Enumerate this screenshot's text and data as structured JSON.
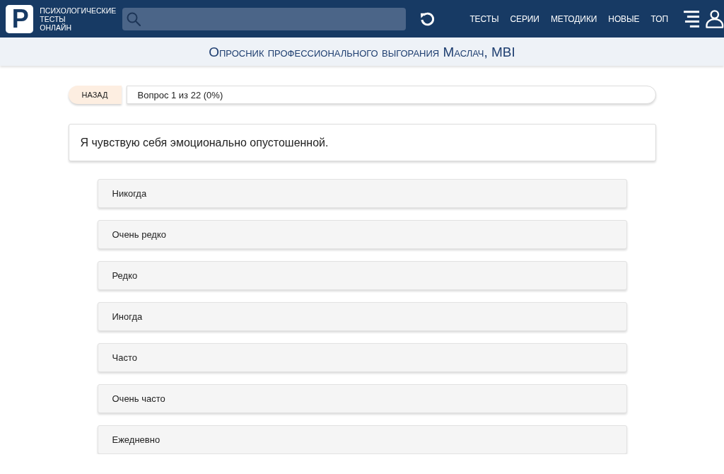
{
  "header": {
    "logo": {
      "letter": "P",
      "lines": [
        "ПСИХОЛОГИЧЕСКИЕ",
        "ТЕСТЫ",
        "ОНЛАЙН"
      ]
    },
    "nav": [
      "ТЕСТЫ",
      "СЕРИИ",
      "МЕТОДИКИ",
      "НОВЫЕ",
      "ТОП"
    ]
  },
  "page_title": "Опросник профессионального выгорания Маслач, MBI",
  "quiz": {
    "back_button": "НАЗАД",
    "progress": "Вопрос 1 из 22 (0%)",
    "question": "Я чувствую себя эмоционально опустошенной.",
    "answers": [
      {
        "label": "Никогда",
        "selected": false
      },
      {
        "label": "Очень редко",
        "selected": false
      },
      {
        "label": "Редко",
        "selected": false
      },
      {
        "label": "Иногда",
        "selected": false
      },
      {
        "label": "Часто",
        "selected": false
      },
      {
        "label": "Очень часто",
        "selected": false
      },
      {
        "label": "Ежедневно",
        "selected": false
      }
    ]
  }
}
